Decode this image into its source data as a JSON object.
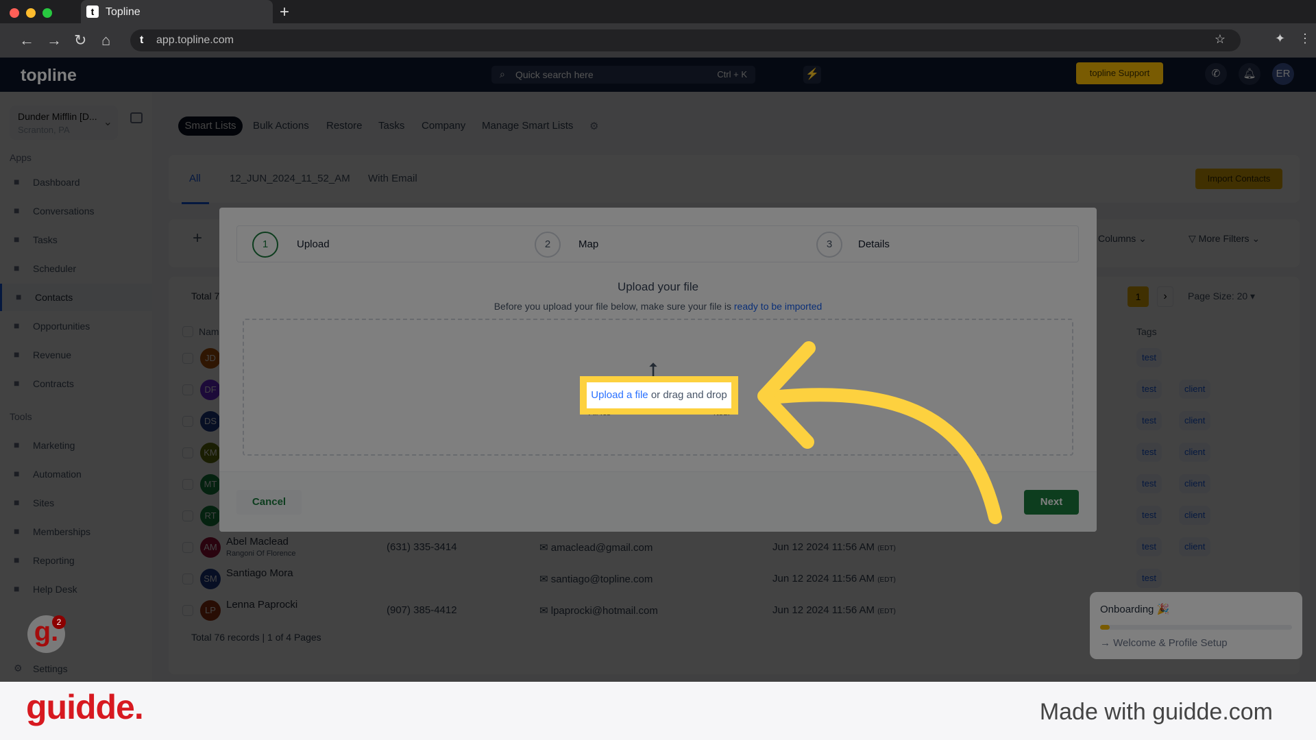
{
  "browser": {
    "tab_title": "Topline",
    "url": "app.topline.com"
  },
  "header": {
    "logo": "topline",
    "search_placeholder": "Quick search here",
    "search_shortcut": "Ctrl + K",
    "support_label": "topline Support",
    "avatar": "ER"
  },
  "sidebar": {
    "company": "Dunder Mifflin [D...",
    "location": "Scranton, PA",
    "apps_label": "Apps",
    "tools_label": "Tools",
    "apps": [
      {
        "label": "Dashboard",
        "icon": "dashboard-icon"
      },
      {
        "label": "Conversations",
        "icon": "chat-icon"
      },
      {
        "label": "Tasks",
        "icon": "task-icon"
      },
      {
        "label": "Scheduler",
        "icon": "calendar-icon"
      },
      {
        "label": "Contacts",
        "icon": "person-icon",
        "active": true
      },
      {
        "label": "Opportunities",
        "icon": "target-icon"
      },
      {
        "label": "Revenue",
        "icon": "card-icon"
      },
      {
        "label": "Contracts",
        "icon": "document-icon"
      }
    ],
    "tools": [
      {
        "label": "Marketing",
        "icon": "megaphone-icon"
      },
      {
        "label": "Automation",
        "icon": "gears-icon"
      },
      {
        "label": "Sites",
        "icon": "globe-icon"
      },
      {
        "label": "Memberships",
        "icon": "users-icon"
      },
      {
        "label": "Reporting",
        "icon": "pie-icon"
      },
      {
        "label": "Help Desk",
        "icon": "help-icon"
      }
    ],
    "settings": "Settings"
  },
  "topnav": [
    "Smart Lists",
    "Bulk Actions",
    "Restore",
    "Tasks",
    "Company",
    "Manage Smart Lists"
  ],
  "listtabs": [
    "All",
    "12_JUN_2024_11_52_AM",
    "With Email"
  ],
  "import_label": "Import Contacts",
  "toolbar": {
    "columns": "Columns",
    "more_filters": "More Filters",
    "total_partial": "Total 7",
    "page": "1",
    "page_size": "Page Size: 20",
    "name_header": "Nam",
    "tags_header": "Tags"
  },
  "rows": [
    {
      "initials": "JD",
      "color": "#b45309",
      "tags": [
        "test"
      ]
    },
    {
      "initials": "DF",
      "color": "#6d28d9",
      "tags": [
        "test",
        "client"
      ]
    },
    {
      "initials": "DS",
      "color": "#1e3a8a",
      "tags": [
        "test",
        "client"
      ]
    },
    {
      "initials": "KM",
      "color": "#65730f",
      "tags": [
        "test",
        "client"
      ]
    },
    {
      "initials": "MT",
      "color": "#15803d",
      "tags": [
        "test",
        "client"
      ]
    },
    {
      "initials": "RT",
      "color": "#15803d",
      "tags": [
        "test",
        "client"
      ]
    },
    {
      "initials": "AM",
      "color": "#9f1239",
      "name": "Abel Maclead",
      "company": "Rangoni Of Florence",
      "phone": "(631) 335-3414",
      "email": "amaclead@gmail.com",
      "date": "Jun 12 2024 11:56 AM",
      "tz": "(EDT)",
      "tags": [
        "test",
        "client"
      ]
    },
    {
      "initials": "SM",
      "color": "#1e3a8a",
      "name": "Santiago Mora",
      "email": "santiago@topline.com",
      "date": "Jun 12 2024 11:56 AM",
      "tz": "(EDT)",
      "tags": [
        "test"
      ]
    },
    {
      "initials": "LP",
      "color": "#9a3412",
      "name": "Lenna Paprocki",
      "phone": "(907) 385-4412",
      "email": "lpaprocki@hotmail.com",
      "date": "Jun 12 2024 11:56 AM",
      "tz": "(EDT)",
      "tags": []
    }
  ],
  "table_footer": "Total 76 records | 1 of 4 Pages",
  "modal": {
    "steps": [
      {
        "num": "1",
        "label": "Upload"
      },
      {
        "num": "2",
        "label": "Map"
      },
      {
        "num": "3",
        "label": "Details"
      }
    ],
    "title": "Upload your file",
    "subtitle": "Before you upload your file below, make sure your file is ",
    "subtitle_link": "ready to be imported",
    "upload_link": "Upload a file",
    "upload_rest": " or drag and drop",
    "hint_start": "All .cs",
    "hint_end": "rted.",
    "cancel": "Cancel",
    "next": "Next"
  },
  "onboarding": {
    "title": "Onboarding 🎉",
    "progress_percent": 5,
    "step": "Welcome & Profile Setup"
  },
  "guidde": {
    "brand": "guidde.",
    "made_with": "Made with guidde.com",
    "badge": "2"
  },
  "colors": {
    "accent": "#fdd13f",
    "primary_green": "#1b7a3c",
    "link": "#155eef"
  }
}
